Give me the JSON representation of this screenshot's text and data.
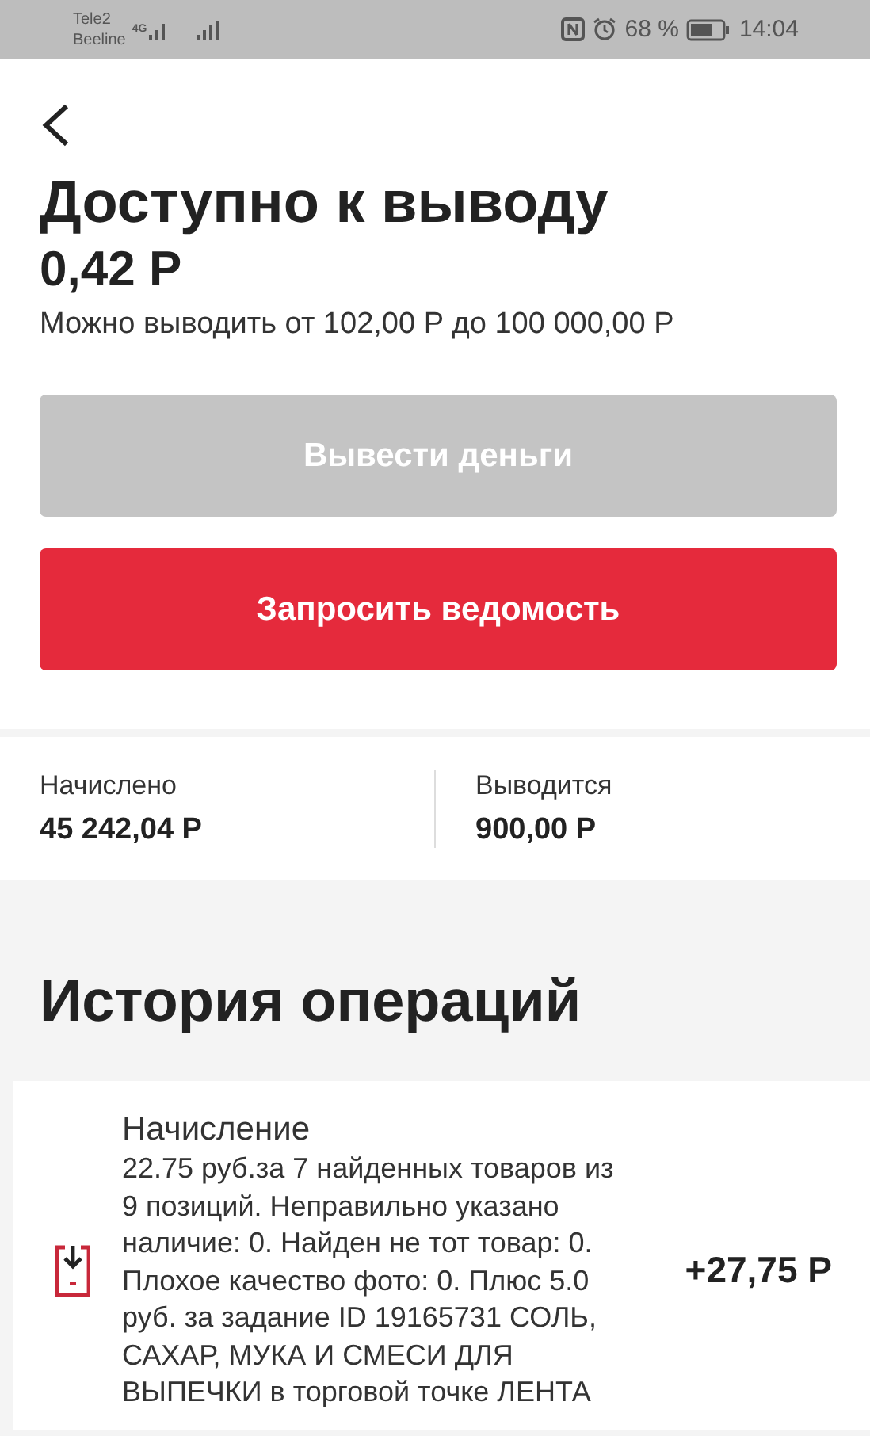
{
  "status_bar": {
    "carriers": [
      "Tele2",
      "Beeline"
    ],
    "network": "4G",
    "battery_text": "68 %",
    "time": "14:04"
  },
  "header": {
    "title": "Доступно к выводу",
    "amount": "0,42 Р",
    "hint": "Можно выводить от 102,00 Р до 100 000,00 Р"
  },
  "buttons": [
    {
      "label": "Вывести деньги",
      "disabled": true
    },
    {
      "label": "Запросить ведомость",
      "disabled": false
    }
  ],
  "stats": [
    {
      "label": "Начислено",
      "value": "45 242,04 Р"
    },
    {
      "label": "Выводится",
      "value": "900,00 Р"
    }
  ],
  "history": {
    "title": "История операций",
    "items": [
      {
        "kind": "accrual",
        "title": "Начисление",
        "description": "22.75 руб.за 7 найденных товаров из 9 позиций. Неправильно указано наличие: 0. Найден не тот товар: 0. Плохое качество фото: 0. Плюс 5.0 руб. за задание ID 19165731 СОЛЬ, САХАР, МУКА И СМЕСИ ДЛЯ ВЫПЕЧКИ в торговой точке ЛЕНТА",
        "amount": "+27,75 Р"
      }
    ]
  }
}
